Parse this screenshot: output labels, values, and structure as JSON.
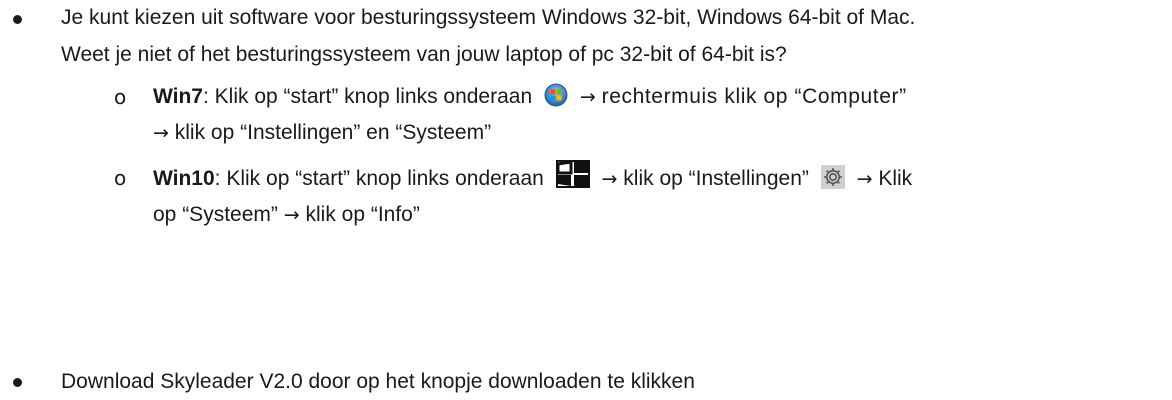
{
  "bullets": [
    {
      "line1": "Je kunt kiezen uit software voor besturingssysteem Windows 32-bit, Windows 64-bit of Mac.",
      "line2": "Weet je niet of het besturingssysteem van jouw laptop of pc 32-bit of 64-bit is?"
    },
    {
      "line1": "Download Skyleader V2.0  door op het knopje downloaden te klikken"
    }
  ],
  "subbullets": [
    {
      "label": "Win7",
      "part1": ": Klik op “start” knop links onderaan",
      "icon": "windows7-start-orb-icon",
      "arrow": "→",
      "part2": "rechtermuis klik op “Computer”",
      "line2_arrow": "→",
      "line2": "klik op “Instellingen” en “Systeem”"
    },
    {
      "label": "Win10",
      "part1": ": Klik op “start” knop links onderaan",
      "icon": "windows10-start-icon",
      "arrow": "→",
      "part2": "klik op “Instellingen”",
      "icon2": "gear-icon",
      "arrow2": "→",
      "part3": "Klik",
      "line2": "op “Systeem”",
      "line2_arrow": "→",
      "line2b": "klik op “Info”"
    }
  ],
  "sub_marker": "o"
}
